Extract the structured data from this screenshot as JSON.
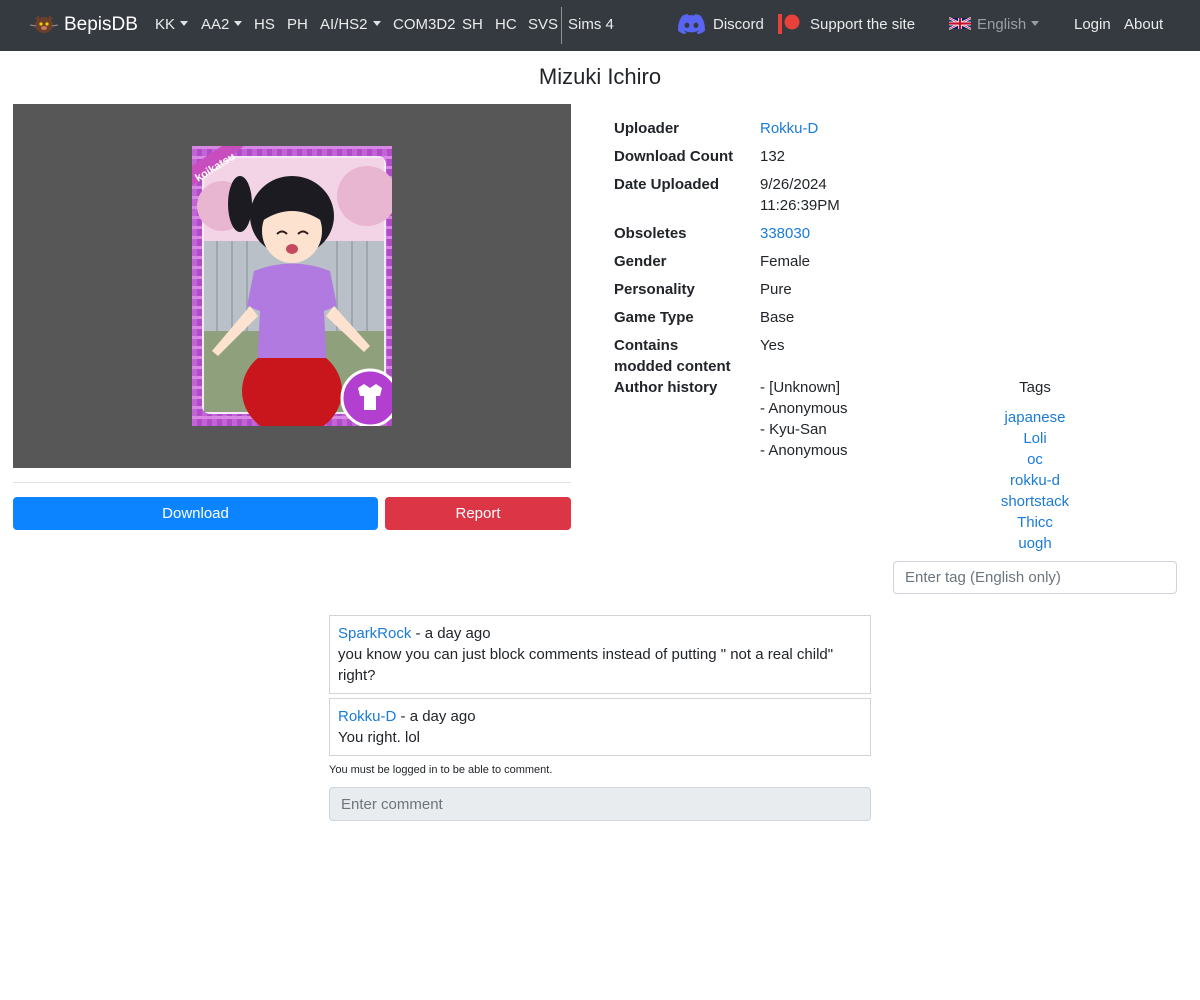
{
  "nav": {
    "brand": "BepisDB",
    "items": [
      {
        "label": "KK",
        "dropdown": true
      },
      {
        "label": "AA2",
        "dropdown": true
      },
      {
        "label": "HS",
        "dropdown": false
      },
      {
        "label": "PH",
        "dropdown": false
      },
      {
        "label": "AI/HS2",
        "dropdown": true
      },
      {
        "label": "COM3D2",
        "dropdown": false
      },
      {
        "label": "SH",
        "dropdown": false
      },
      {
        "label": "HC",
        "dropdown": false
      },
      {
        "label": "SVS",
        "dropdown": false
      },
      {
        "label": "Sims 4",
        "dropdown": false
      }
    ],
    "discord": "Discord",
    "support": "Support the site",
    "language": "English",
    "login": "Login",
    "about": "About"
  },
  "page_title": "Mizuki Ichiro",
  "card": {
    "stamp_text": "koikatsu"
  },
  "buttons": {
    "download": "Download",
    "report": "Report"
  },
  "info": [
    {
      "label": "Uploader",
      "value": "Rokku-D",
      "link": true
    },
    {
      "label": "Download Count",
      "value": "132",
      "link": false
    },
    {
      "label": "Date Uploaded",
      "value": "9/26/2024",
      "value2": "11:26:39PM",
      "link": false
    },
    {
      "label": "Obsoletes",
      "value": "338030",
      "link": true
    },
    {
      "label": "Gender",
      "value": "Female",
      "link": false
    },
    {
      "label": "Personality",
      "value": "Pure",
      "link": false
    },
    {
      "label": "Game Type",
      "value": "Base",
      "link": false
    },
    {
      "label": "Contains",
      "label2": "modded content",
      "value": "Yes",
      "link": false
    },
    {
      "label": "Author history",
      "history": [
        "- [Unknown]",
        "- Anonymous",
        "- Kyu-San",
        "- Anonymous"
      ]
    }
  ],
  "tags": {
    "title": "Tags",
    "items": [
      "japanese",
      "Loli",
      "oc",
      "rokku-d",
      "shortstack",
      "Thicc",
      "uogh"
    ],
    "placeholder": "Enter tag (English only)"
  },
  "comments": [
    {
      "author": "SparkRock",
      "meta": " - a day ago",
      "text": "you know you can just block comments instead of putting \" not a real child\"",
      "text2": "right?"
    },
    {
      "author": "Rokku-D",
      "meta": " - a day ago",
      "text": "You right. lol"
    }
  ],
  "comment_note": "You must be logged in to be able to comment.",
  "comment_placeholder": "Enter comment",
  "colors": {
    "navbar": "#343a40",
    "link": "#1a7bd8",
    "download": "#0d84ff",
    "report": "#dc3545"
  }
}
